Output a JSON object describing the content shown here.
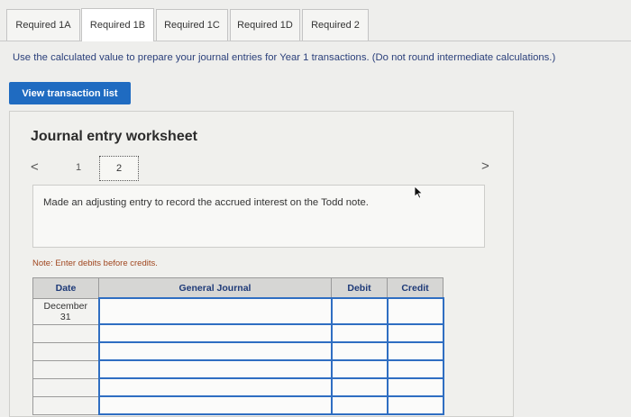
{
  "tabs": [
    {
      "label": "Required 1A"
    },
    {
      "label": "Required 1B"
    },
    {
      "label": "Required 1C"
    },
    {
      "label": "Required 1D"
    },
    {
      "label": "Required 2"
    }
  ],
  "active_tab": "Required 1B",
  "instructions": "Use the calculated value to prepare your journal entries for Year 1 transactions. (Do not round intermediate calculations.)",
  "view_button_label": "View transaction list",
  "worksheet": {
    "title": "Journal entry worksheet",
    "pager": {
      "prev": "<",
      "page1": "1",
      "page2": "2",
      "next": ">"
    },
    "description": "Made an adjusting entry to record the accrued interest on the Todd note.",
    "note": "Note: Enter debits before credits.",
    "table": {
      "headers": {
        "date": "Date",
        "account": "General Journal",
        "debit": "Debit",
        "credit": "Credit"
      },
      "first_date_line1": "December",
      "first_date_line2": "31"
    }
  }
}
